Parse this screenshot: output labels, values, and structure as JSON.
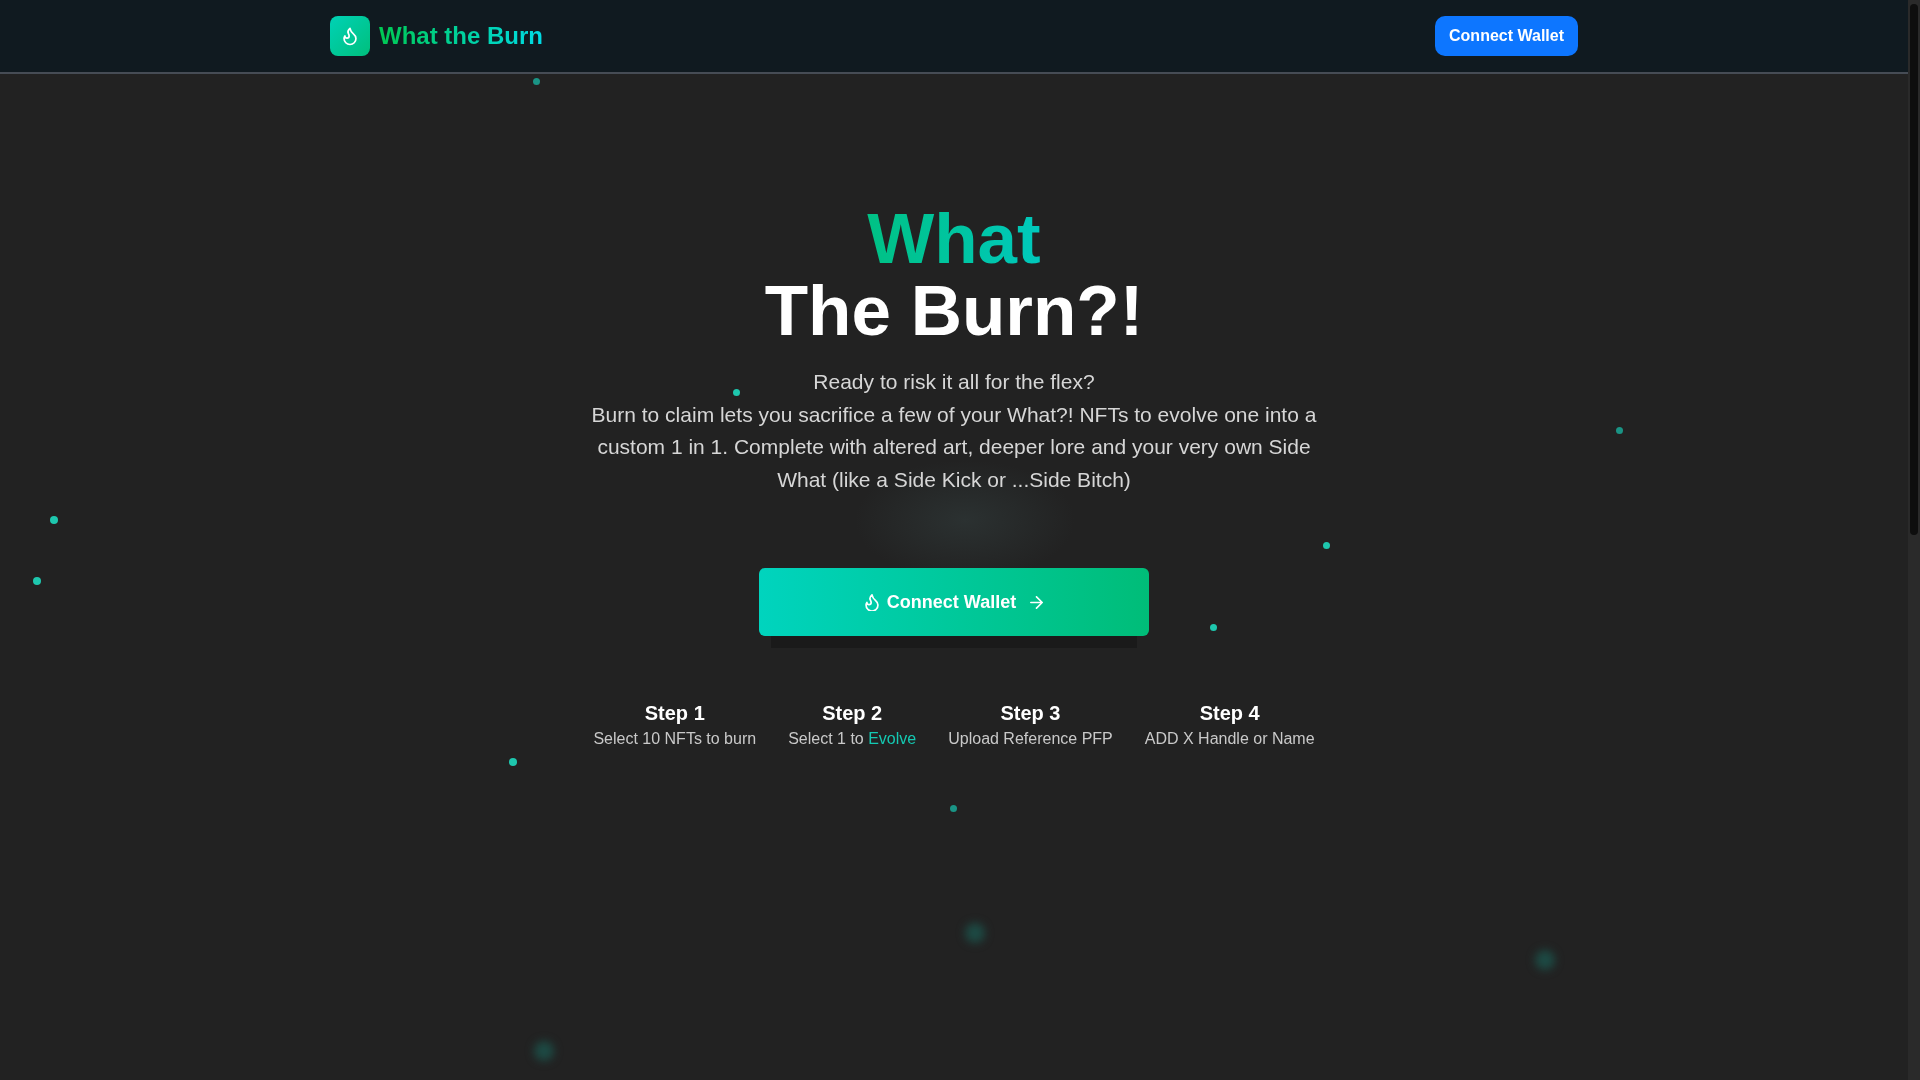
{
  "header": {
    "brand": "What the Burn",
    "connect_button": "Connect Wallet"
  },
  "hero": {
    "title_accent": "What",
    "title": "The Burn?!",
    "tagline": "Ready to risk it all for the flex?",
    "description": "Burn to claim lets you sacrifice a few of your What?! NFTs to evolve one into a custom 1 in 1. Complete with altered art, deeper lore and your very own Side What (like a Side Kick or ...Side Bitch)",
    "cta": "Connect Wallet"
  },
  "steps": [
    {
      "title": "Step 1",
      "description": [
        {
          "text": "Select 10 NFTs to burn",
          "accent": false
        }
      ]
    },
    {
      "title": "Step 2",
      "description": [
        {
          "text": "Select 1 to ",
          "accent": false
        },
        {
          "text": "Evolve",
          "accent": true
        }
      ]
    },
    {
      "title": "Step 3",
      "description": [
        {
          "text": "Upload Reference PFP",
          "accent": false
        }
      ]
    },
    {
      "title": "Step 4",
      "description": [
        {
          "text": "ADD X Handle or Name",
          "accent": false
        }
      ]
    }
  ]
}
